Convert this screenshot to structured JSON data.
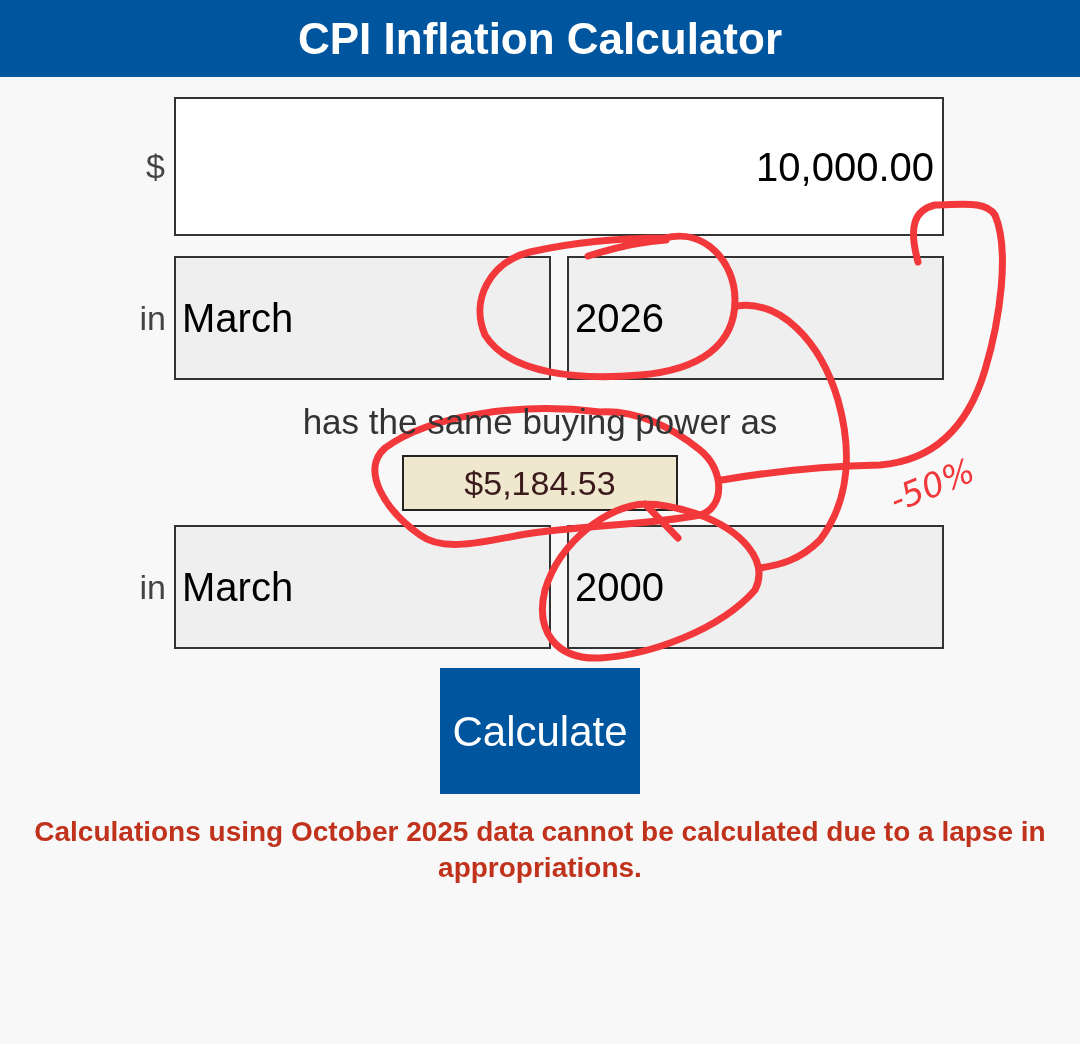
{
  "header": {
    "title": "CPI Inflation Calculator"
  },
  "amount": {
    "prefix": "$",
    "value": "10,000.00"
  },
  "from": {
    "label": "in",
    "month": "March",
    "year": "2026"
  },
  "connector_text": "has the same buying power as",
  "result": "$5,184.53",
  "to": {
    "label": "in",
    "month": "March",
    "year": "2000"
  },
  "calculate_button": "Calculate",
  "notice": "Calculations using October 2025 data cannot be calculated due to a lapse in appropriations.",
  "annotation": {
    "note": "-50%"
  }
}
